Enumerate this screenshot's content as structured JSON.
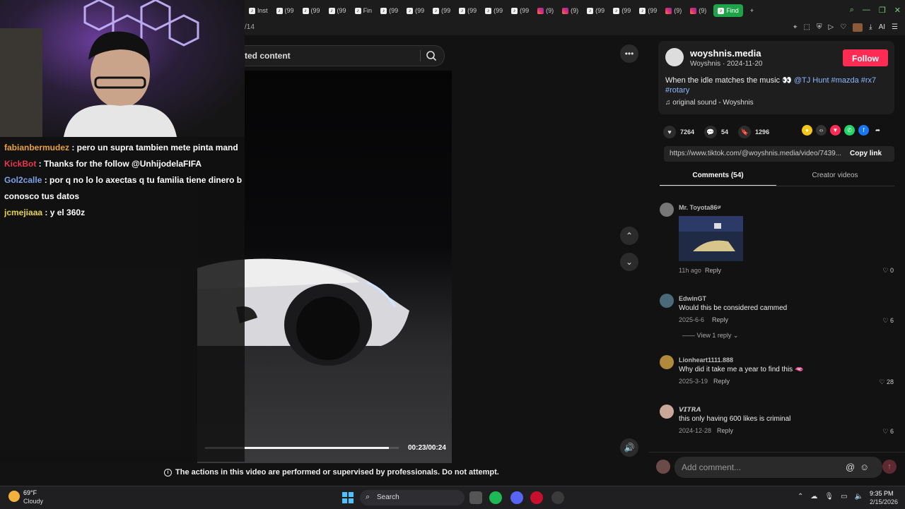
{
  "browser": {
    "tabs": [
      {
        "icon": "tiktok",
        "label": "Inst"
      },
      {
        "icon": "tiktok",
        "label": "(99"
      },
      {
        "icon": "tiktok",
        "label": "(99"
      },
      {
        "icon": "tiktok",
        "label": "(99"
      },
      {
        "icon": "tiktok",
        "label": "Fin"
      },
      {
        "icon": "tiktok",
        "label": "(99"
      },
      {
        "icon": "tiktok",
        "label": "(99"
      },
      {
        "icon": "tiktok",
        "label": "(99"
      },
      {
        "icon": "tiktok",
        "label": "(99"
      },
      {
        "icon": "tiktok",
        "label": "(99"
      },
      {
        "icon": "tiktok",
        "label": "(99"
      },
      {
        "icon": "instagram",
        "label": "(9)"
      },
      {
        "icon": "instagram",
        "label": "(9)"
      },
      {
        "icon": "tiktok",
        "label": "(99"
      },
      {
        "icon": "tiktok",
        "label": "(99"
      },
      {
        "icon": "tiktok",
        "label": "(99"
      },
      {
        "icon": "instagram",
        "label": "(9)"
      },
      {
        "icon": "instagram",
        "label": "(9)"
      }
    ],
    "active_tab": "Find",
    "url_fragment": "/14",
    "new_tab_symbol": "+"
  },
  "search": {
    "text": "ted content"
  },
  "video": {
    "time": "00:23/00:24",
    "progress": 0.95,
    "warning": "The actions in this video are performed or supervised by professionals. Do not attempt."
  },
  "chat": [
    {
      "user": "fabianbermudez",
      "user_color": "#e8a23a",
      "message": " : pero un supra tambien mete pinta mand"
    },
    {
      "user": "KickBot",
      "user_color": "#e8374b",
      "message": " : Thanks for the follow @UnhijodelaFIFA"
    },
    {
      "user": "Gol2calle",
      "user_color": "#7fa3e8",
      "message": " : por q no lo lo axectas q tu familia tiene dinero b"
    },
    {
      "user": "",
      "user_color": "#ffffff",
      "message": "conosco tus datos"
    },
    {
      "user": "jcmejiaaa",
      "user_color": "#e8d44a",
      "message": " : y el 360z"
    }
  ],
  "post": {
    "author": "woyshnis.media",
    "author_sub": "Woyshnis · 2024-11-20",
    "follow_label": "Follow",
    "caption_text": "When the idle matches the music 👀 ",
    "caption_tags": "@TJ Hunt #mazda #rx7",
    "caption_tag2": "#rotary",
    "sound": "original sound - Woyshnis",
    "likes": "7264",
    "comments": "54",
    "saves": "1296",
    "link": "https://www.tiktok.com/@woyshnis.media/video/7439...",
    "copy_label": "Copy link"
  },
  "tabs": {
    "comments": "Comments (54)",
    "creator": "Creator videos"
  },
  "comments": [
    {
      "user": "Mr. Toyota86ᵍʳ",
      "text": "",
      "date": "11h ago",
      "reply": "Reply",
      "likes": "0"
    },
    {
      "user": "EdwinGT",
      "text": "Would this be considered cammed",
      "date": "2025-6-6",
      "reply": "Reply",
      "likes": "6",
      "view_replies": "View 1 reply"
    },
    {
      "user": "Lionheart1111.888",
      "text": "Why did it take me a year to find this 🫦",
      "date": "2025-3-19",
      "reply": "Reply",
      "likes": "28"
    },
    {
      "user": "𝙑𝙄𝙏𝙍𝘼",
      "text": "this only having 600 likes is criminal",
      "date": "2024-12-28",
      "reply": "Reply",
      "likes": "6"
    }
  ],
  "comment_box": {
    "placeholder": "Add comment..."
  },
  "taskbar": {
    "temp": "69°F",
    "condition": "Cloudy",
    "search_label": "Search",
    "time": "9:35 PM",
    "date": "2/15/2026"
  }
}
